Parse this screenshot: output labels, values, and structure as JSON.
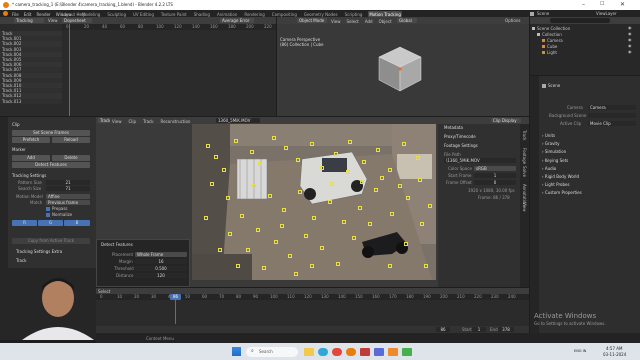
{
  "window": {
    "title": "* camera_tracking_1 (E:\\Blender 4\\camera_tracking_1.blend) - Blender 4.2.2 LTS",
    "menu": [
      "File",
      "Edit",
      "Render",
      "Window",
      "Help"
    ],
    "workspaces": [
      "Layout",
      "Modeling",
      "Sculpting",
      "UV Editing",
      "Texture Paint",
      "Shading",
      "Animation",
      "Rendering",
      "Compositing",
      "Geometry Nodes",
      "Scripting",
      "Motion Tracking"
    ],
    "active_workspace": "Motion Tracking",
    "scene": "Scene",
    "view_layer": "ViewLayer"
  },
  "dopesheet": {
    "mode": "Tracking",
    "view_label": "View",
    "filter": "Dopesheet",
    "sort": "Average Error",
    "frames": [
      "0",
      "20",
      "40",
      "60",
      "80",
      "100",
      "120",
      "140",
      "160",
      "180",
      "200",
      "220"
    ],
    "tracks": [
      "Track",
      "Track.001",
      "Track.002",
      "Track.003",
      "Track.004",
      "Track.005",
      "Track.006",
      "Track.007",
      "Track.008",
      "Track.009",
      "Track.010",
      "Track.011",
      "Track.012",
      "Track.013"
    ]
  },
  "viewport": {
    "mode": "Object Mode",
    "menu": [
      "View",
      "Select",
      "Add",
      "Object"
    ],
    "orientation": "Global",
    "options": "Options",
    "title": "Camera Perspective",
    "subtitle": "(86) Collection | Cube"
  },
  "outliner": {
    "search_placeholder": "",
    "items": [
      {
        "label": "Scene Collection",
        "indent": 0,
        "color": "#bbbbbb"
      },
      {
        "label": "Collection",
        "indent": 1,
        "color": "#bbbbbb"
      },
      {
        "label": "Camera",
        "indent": 2,
        "color": "#d78b3a"
      },
      {
        "label": "Cube",
        "indent": 2,
        "color": "#d78b3a"
      },
      {
        "label": "Light",
        "indent": 2,
        "color": "#d78b3a"
      }
    ]
  },
  "properties": {
    "title": "Scene",
    "camera_label": "Camera",
    "camera_value": "Camera",
    "bg_scene_label": "Background Scene",
    "active_clip_label": "Active Clip",
    "active_clip_value": "Movie Clip",
    "sections": [
      "Units",
      "Gravity",
      "Simulation",
      "Keying Sets",
      "Audio",
      "Rigid Body World",
      "Light Probes",
      "Custom Properties"
    ]
  },
  "clip_editor": {
    "mode": "Tracking",
    "menu": [
      "View",
      "Clip",
      "Track",
      "Reconstruction"
    ],
    "clip_name": "1360_5MiK.MOV",
    "clip_display": "Clip Display",
    "tabs_right": [
      "Track",
      "Footage",
      "Solve",
      "Annotation",
      "View"
    ]
  },
  "tool_panel": {
    "clip_header": "Clip",
    "set_scene_frames": "Set Scene Frames",
    "prefetch": "Prefetch",
    "reload": "Reload",
    "marker_header": "Marker",
    "add": "Add",
    "delete": "Delete",
    "detect_features": "Detect Features",
    "tracking_settings": "Tracking Settings",
    "pattern_size_label": "Pattern Size",
    "pattern_size": "21",
    "search_size_label": "Search Size",
    "search_size": "71",
    "motion_model_label": "Motion Model",
    "motion_model": "Affine",
    "match_label": "Match",
    "match": "Previous frame",
    "prepass": "Prepass",
    "normalize": "Normalize",
    "channel_r": "R",
    "channel_g": "G",
    "channel_b": "B",
    "copy_from_active": "Copy from Active Track",
    "tracking_settings_extra": "Tracking Settings Extra",
    "track_header": "Track"
  },
  "detect_popup": {
    "title": "Detect Features",
    "placement_label": "Placement",
    "placement": "Whole Frame",
    "margin_label": "Margin",
    "margin": "16",
    "threshold_label": "Threshold",
    "threshold": "0.500",
    "distance_label": "Distance",
    "distance": "120"
  },
  "clip_sidebar": {
    "metadata": "Metadata",
    "proxy": "Proxy/Timecode",
    "footage_settings": "Footage Settings",
    "file_path_label": "File Path",
    "file_path": "\\1360_5MiK.MOV",
    "color_space_label": "Color Space",
    "color_space": "sRGB",
    "start_frame_label": "Start Frame",
    "start_frame": "1",
    "frame_offset_label": "Frame Offset",
    "frame_offset": "0",
    "resolution": "1920 x 1080, 30.00 fps",
    "frame_info": "Frame: 86 / 378"
  },
  "timeline": {
    "select_label": "Select",
    "frames": [
      "0",
      "10",
      "20",
      "30",
      "40",
      "50",
      "60",
      "70",
      "80",
      "90",
      "100",
      "110",
      "120",
      "130",
      "140",
      "150",
      "160",
      "170",
      "180",
      "190",
      "200",
      "210",
      "220",
      "230",
      "240"
    ],
    "current_frame": "86",
    "start_label": "Start",
    "start": "1",
    "end_label": "End",
    "end": "378"
  },
  "status_bar": {
    "context_menu": "Context Menu",
    "activate_title": "Activate Windows",
    "activate_sub": "Go to Settings to activate Windows."
  },
  "taskbar": {
    "search_placeholder": "Search",
    "tray": "ENG IN",
    "time": "4:57 AM",
    "date": "03-11-2024"
  },
  "colors": {
    "accent": "#4772b3",
    "marker": "#e8e040",
    "playhead": "#4772b3"
  }
}
